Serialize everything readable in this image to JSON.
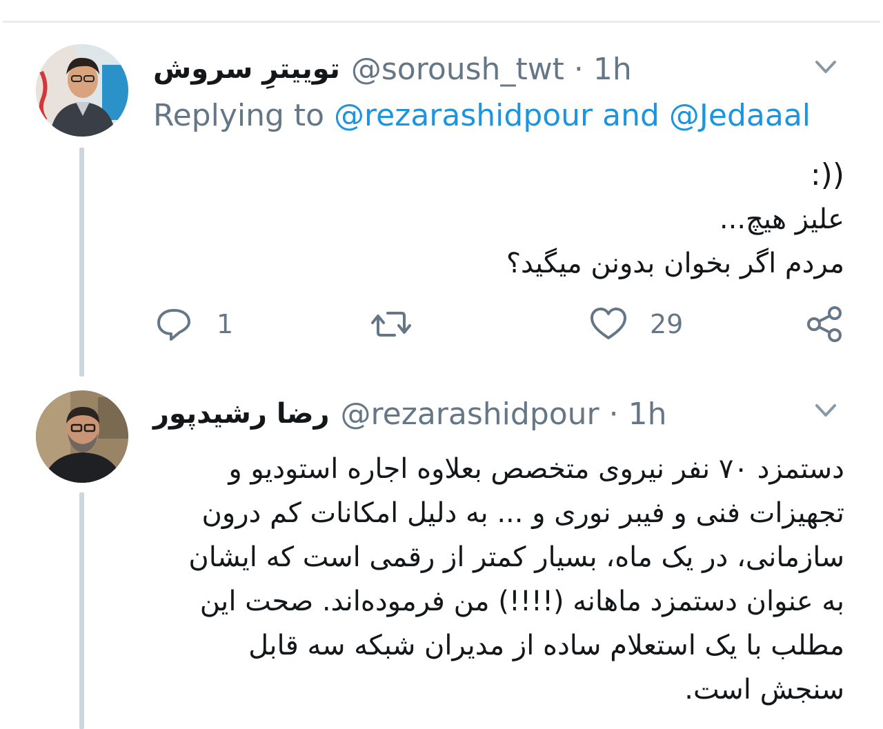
{
  "tweets": [
    {
      "display_name": "توییترِ سروش",
      "handle": "@soroush_twt",
      "time": "1h",
      "replying_prefix": "Replying to ",
      "reply_to_1": "@rezarashidpour",
      "reply_to_join": " and ",
      "reply_to_2": "@Jedaaal",
      "text_lines": [
        ":))",
        "علیز هیچ...",
        "مردم اگر بخوان بدونن میگید؟"
      ],
      "reply_count": "1",
      "like_count": "29"
    },
    {
      "display_name": "رضا رشیدپور",
      "handle": "@rezarashidpour",
      "time": "1h",
      "text_lines": [
        "دستمزد ۷۰ نفر نیروی متخصص بعلاوه اجاره استودیو و",
        "تجهیزات فنی و فیبر نوری و ... به دلیل امکانات کم درون",
        "سازمانی، در یک ماه، بسیار کمتر از رقمی است که ایشان",
        "به عنوان دستمزد ماهانه (!!!!) من فرموده‌اند. صحت این",
        "مطلب با یک استعلام ساده از مدیران شبکه سه قابل",
        "سنجش است."
      ]
    }
  ],
  "separator": " · ",
  "colors": {
    "link": "#1b95e0",
    "secondary_text": "#657786",
    "thread_line": "#ccd6dd"
  },
  "icons": [
    "reply-icon",
    "retweet-icon",
    "like-icon",
    "share-icon",
    "chevron-down-icon"
  ]
}
